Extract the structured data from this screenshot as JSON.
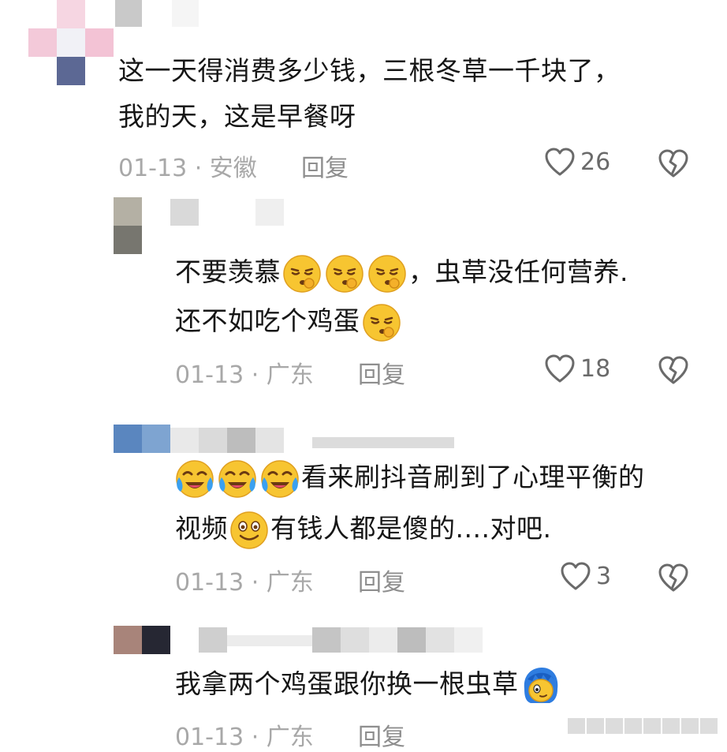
{
  "comments": [
    {
      "lines": [
        "这一天得消费多少钱，三根冬草一千块了，",
        "我的天，这是早餐呀"
      ],
      "date": "01-13",
      "location": "安徽",
      "reply_label": "回复",
      "likes": "26"
    },
    {
      "line1_before": "不要羡慕",
      "line1_after": "，虫草没任何营养.",
      "line2": "还不如吃个鸡蛋",
      "date": "01-13",
      "location": "广东",
      "reply_label": "回复",
      "likes": "18",
      "emoji_icon": "tired-emoji"
    },
    {
      "line1_after": "看来刷抖音刷到了心理平衡的",
      "line2_before": "视频",
      "line2_after": "有钱人都是傻的....对吧.",
      "date": "01-13",
      "location": "广东",
      "reply_label": "回复",
      "likes": "3",
      "emoji_icons": [
        "crying-laughing-emoji",
        "smile-emoji"
      ]
    },
    {
      "line1": "我拿两个鸡蛋跟你换一根虫草",
      "date": "01-13",
      "location": "广东",
      "reply_label": "回复",
      "emoji_icon": "blue-hair-avatar-emoji"
    }
  ],
  "separator": " · ",
  "colors": {
    "text": "#161616",
    "meta": "#a8a8a8",
    "icon": "#6a6a6a",
    "emoji_yellow": "#f7c531"
  }
}
